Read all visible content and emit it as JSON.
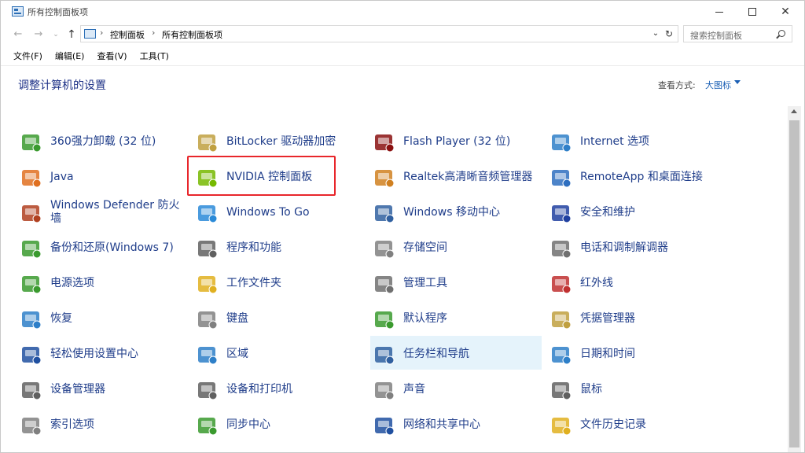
{
  "window": {
    "title": "所有控制面板项",
    "controls": {
      "minimize": "",
      "maximize": "",
      "close": "✕"
    }
  },
  "address": {
    "back": "←",
    "forward": "→",
    "recent": "⌄",
    "up": "↑",
    "separator": "›",
    "crumbs": [
      "控制面板",
      "所有控制面板项"
    ],
    "dropdown": "⌄",
    "refresh": "↻",
    "search_placeholder": "搜索控制面板"
  },
  "menu": [
    "文件(F)",
    "编辑(E)",
    "查看(V)",
    "工具(T)"
  ],
  "heading": {
    "title": "调整计算机的设置",
    "view_label": "查看方式:",
    "view_value": "大图标"
  },
  "items": [
    {
      "label": "360强力卸载 (32 位)",
      "icon": "uninstall-box-icon",
      "color": "#3a9a2e"
    },
    {
      "label": "BitLocker 驱动器加密",
      "icon": "bitlocker-key-icon",
      "color": "#c0a040"
    },
    {
      "label": "Flash Player (32 位)",
      "icon": "flash-player-icon",
      "color": "#8a1010"
    },
    {
      "label": "Internet 选项",
      "icon": "internet-globe-icon",
      "color": "#2e7fc8"
    },
    {
      "label": "Java",
      "icon": "java-cup-icon",
      "color": "#e07020"
    },
    {
      "label": "NVIDIA 控制面板",
      "icon": "nvidia-icon",
      "color": "#76b900"
    },
    {
      "label": "Realtek高清晰音频管理器",
      "icon": "realtek-audio-icon",
      "color": "#d08020"
    },
    {
      "label": "RemoteApp 和桌面连接",
      "icon": "remoteapp-icon",
      "color": "#2e6fc0"
    },
    {
      "label": "Windows Defender 防火墙",
      "icon": "firewall-icon",
      "color": "#b04020"
    },
    {
      "label": "Windows To Go",
      "icon": "windows-to-go-icon",
      "color": "#2a8ad8"
    },
    {
      "label": "Windows 移动中心",
      "icon": "mobility-center-icon",
      "color": "#3060a0"
    },
    {
      "label": "安全和维护",
      "icon": "security-flag-icon",
      "color": "#2040a0"
    },
    {
      "label": "备份和还原(Windows 7)",
      "icon": "backup-restore-icon",
      "color": "#3a9a2e"
    },
    {
      "label": "程序和功能",
      "icon": "programs-features-icon",
      "color": "#606060"
    },
    {
      "label": "存储空间",
      "icon": "storage-spaces-icon",
      "color": "#808080"
    },
    {
      "label": "电话和调制解调器",
      "icon": "phone-modem-icon",
      "color": "#707070"
    },
    {
      "label": "电源选项",
      "icon": "power-options-icon",
      "color": "#3a9a2e"
    },
    {
      "label": "工作文件夹",
      "icon": "work-folders-icon",
      "color": "#e0b020"
    },
    {
      "label": "管理工具",
      "icon": "admin-tools-icon",
      "color": "#707070"
    },
    {
      "label": "红外线",
      "icon": "infrared-icon",
      "color": "#c03030"
    },
    {
      "label": "恢复",
      "icon": "recovery-icon",
      "color": "#2e7fc8"
    },
    {
      "label": "键盘",
      "icon": "keyboard-icon",
      "color": "#808080"
    },
    {
      "label": "默认程序",
      "icon": "default-programs-icon",
      "color": "#3a9a2e"
    },
    {
      "label": "凭据管理器",
      "icon": "credential-manager-icon",
      "color": "#c0a040"
    },
    {
      "label": "轻松使用设置中心",
      "icon": "ease-of-access-icon",
      "color": "#2050a0"
    },
    {
      "label": "区域",
      "icon": "region-globe-icon",
      "color": "#2e7fc8"
    },
    {
      "label": "任务栏和导航",
      "icon": "taskbar-navigation-icon",
      "color": "#3060a0"
    },
    {
      "label": "日期和时间",
      "icon": "date-time-icon",
      "color": "#2e7fc8"
    },
    {
      "label": "设备管理器",
      "icon": "device-manager-icon",
      "color": "#606060"
    },
    {
      "label": "设备和打印机",
      "icon": "devices-printers-icon",
      "color": "#606060"
    },
    {
      "label": "声音",
      "icon": "sound-speaker-icon",
      "color": "#808080"
    },
    {
      "label": "鼠标",
      "icon": "mouse-icon",
      "color": "#606060"
    },
    {
      "label": "索引选项",
      "icon": "indexing-options-icon",
      "color": "#808080"
    },
    {
      "label": "同步中心",
      "icon": "sync-center-icon",
      "color": "#3a9a2e"
    },
    {
      "label": "网络和共享中心",
      "icon": "network-sharing-icon",
      "color": "#2050a0"
    },
    {
      "label": "文件历史记录",
      "icon": "file-history-icon",
      "color": "#e0b020"
    }
  ]
}
